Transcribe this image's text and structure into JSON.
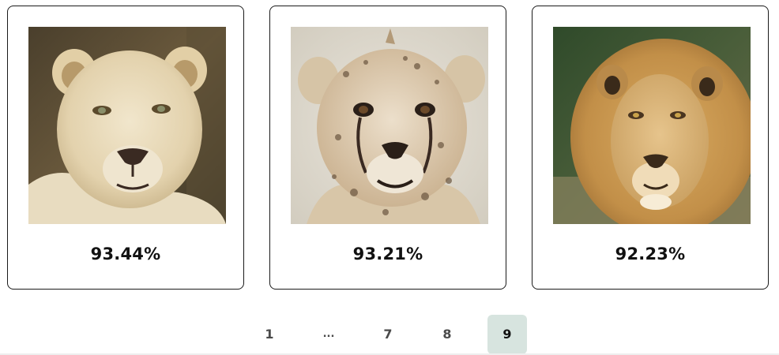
{
  "results": [
    {
      "score": "93.44%",
      "image": "white-lioness-photo"
    },
    {
      "score": "93.21%",
      "image": "cheetah-cub-photo"
    },
    {
      "score": "92.23%",
      "image": "male-lion-photo"
    }
  ],
  "pagination": {
    "items": [
      "1",
      "...",
      "7",
      "8",
      "9"
    ],
    "current": "9"
  },
  "colors": {
    "active_page_bg": "#d7e4df",
    "card_border": "#1a1a1a"
  }
}
